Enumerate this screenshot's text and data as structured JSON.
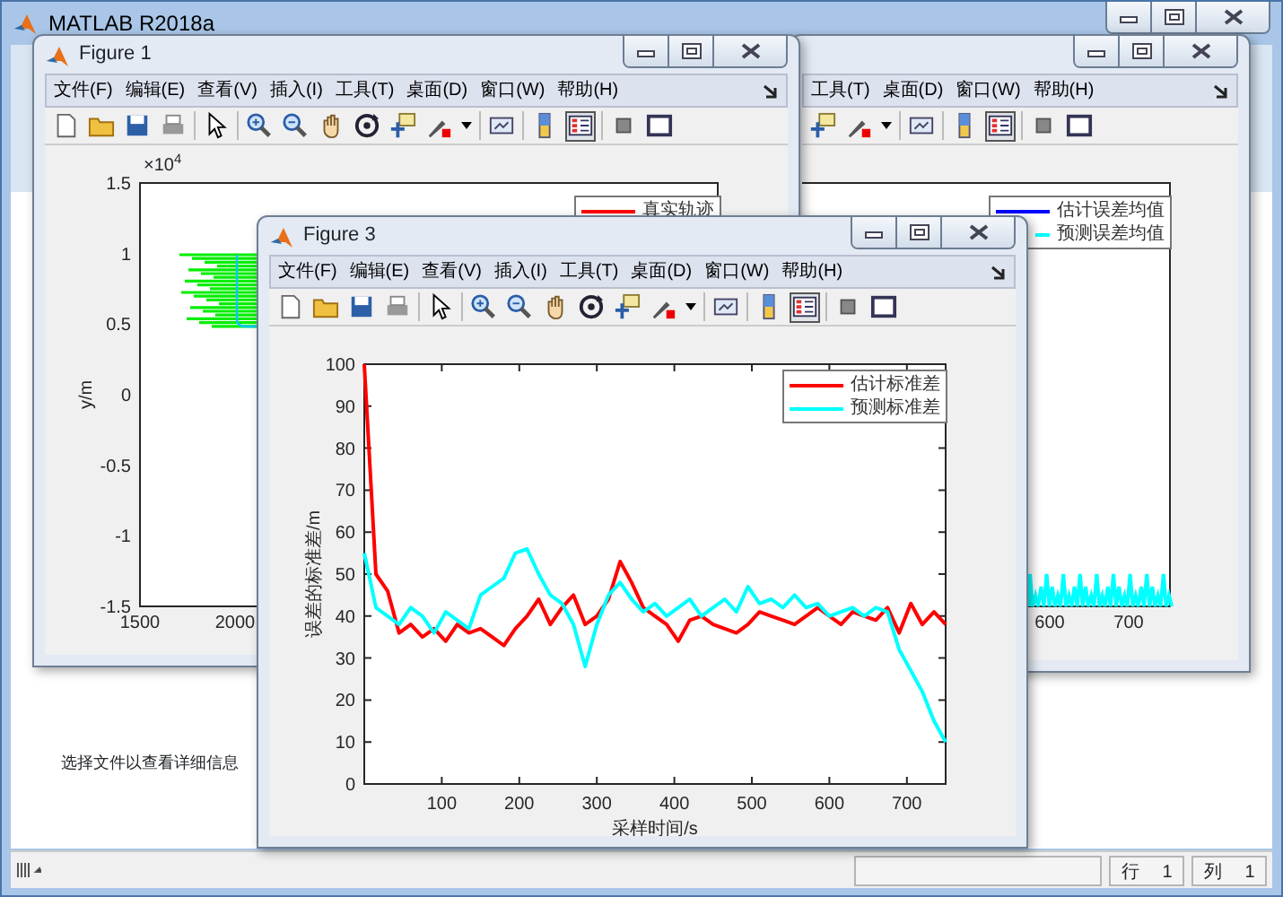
{
  "main_window": {
    "title": "MATLAB R2018a",
    "details_hint": "选择文件以查看详细信息",
    "status_bar": {
      "row": "行 1",
      "column": "列 1"
    }
  },
  "figures": [
    {
      "menu": [
        "工具(T)",
        "桌面(D)",
        "窗口(W)",
        "帮助(H)"
      ],
      "legend_button_pressed": true,
      "axes": {
        "xticks": [
          "600",
          "700"
        ],
        "legend": [
          {
            "name": "估计误差均值",
            "color": "#0000ff"
          },
          {
            "name": "预测误差均值",
            "color": "#00ffff"
          }
        ]
      }
    },
    {
      "title": "Figure 1",
      "menu": [
        "文件(F)",
        "编辑(E)",
        "查看(V)",
        "插入(I)",
        "工具(T)",
        "桌面(D)",
        "窗口(W)",
        "帮助(H)"
      ],
      "legend_button_pressed": true,
      "axes": {
        "ylabel": "y/m",
        "exponent": "×10$^{4}$",
        "yticks": [
          "1.5",
          "1",
          "0.5",
          "0",
          "-0.5",
          "-1",
          "-1.5"
        ],
        "xticks": [
          "1500",
          "2000"
        ],
        "legend": [
          {
            "name": "真实轨迹",
            "color": "#ff0000"
          }
        ]
      }
    },
    {
      "title": "Figure 3",
      "menu": [
        "文件(F)",
        "编辑(E)",
        "查看(V)",
        "插入(I)",
        "工具(T)",
        "桌面(D)",
        "窗口(W)",
        "帮助(H)"
      ],
      "legend_button_pressed": true,
      "chart_data": {
        "type": "line",
        "legend": "upper right",
        "xlabel": "采样时间/s",
        "ylabel": "误差的标准差/m",
        "xlim": [
          0,
          750
        ],
        "ylim": [
          0,
          100
        ],
        "xticks": [
          100,
          200,
          300,
          400,
          500,
          600,
          700
        ],
        "yticks": [
          0,
          10,
          20,
          30,
          40,
          50,
          60,
          70,
          80,
          90,
          100
        ],
        "x": [
          0,
          15,
          30,
          45,
          60,
          75,
          90,
          105,
          120,
          135,
          150,
          165,
          180,
          195,
          210,
          225,
          240,
          255,
          270,
          285,
          300,
          315,
          330,
          345,
          360,
          375,
          390,
          405,
          420,
          435,
          450,
          465,
          480,
          495,
          510,
          525,
          540,
          555,
          570,
          585,
          600,
          615,
          630,
          645,
          660,
          675,
          690,
          705,
          720,
          735,
          750
        ],
        "series": [
          {
            "name": "估计标准差",
            "color": "#ff0000",
            "values": [
              100,
              50,
              46,
              36,
              38,
              35,
              37,
              34,
              38,
              36,
              37,
              35,
              33,
              37,
              40,
              44,
              38,
              42,
              45,
              38,
              40,
              44,
              53,
              48,
              42,
              40,
              38,
              34,
              39,
              40,
              38,
              37,
              36,
              38,
              41,
              40,
              39,
              38,
              40,
              42,
              40,
              38,
              41,
              40,
              39,
              42,
              36,
              43,
              38,
              41,
              38
            ]
          },
          {
            "name": "预测标准差",
            "color": "#00ffff",
            "values": [
              55,
              42,
              40,
              38,
              42,
              40,
              36,
              41,
              39,
              37,
              45,
              47,
              49,
              55,
              56,
              50,
              45,
              43,
              38,
              28,
              38,
              45,
              48,
              44,
              41,
              43,
              40,
              42,
              44,
              40,
              42,
              44,
              41,
              47,
              43,
              44,
              42,
              45,
              42,
              43,
              40,
              41,
              42,
              40,
              42,
              41,
              32,
              27,
              22,
              15,
              10
            ]
          }
        ]
      }
    }
  ]
}
